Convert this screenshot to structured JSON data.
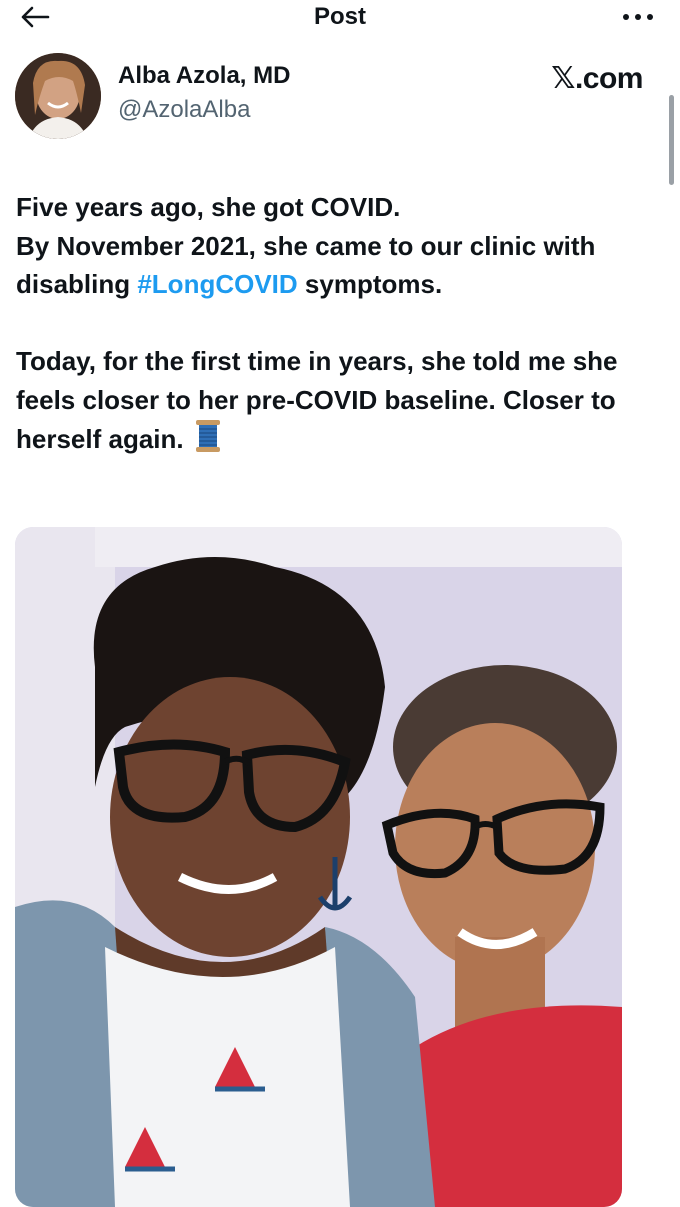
{
  "header": {
    "title": "Post",
    "back_icon": "arrow-left-icon",
    "more_icon": "more-horizontal-icon"
  },
  "author": {
    "name": "Alba Azola, MD",
    "handle": "@AzolaAlba",
    "brand": "𝕏.com"
  },
  "post": {
    "line1": "Five years ago, she got COVID.",
    "line2a": "By November 2021, she came to our clinic with disabling ",
    "hashtag": "#LongCOVID",
    "line2b": " symptoms.",
    "para2": "Today, for the first time in years, she told me she feels closer to her pre-COVID baseline. Closer to herself again.",
    "emoji_icon": "spool-of-thread-icon"
  },
  "colors": {
    "link": "#1d9bf0",
    "text": "#0f1419",
    "secondary": "#536471"
  }
}
